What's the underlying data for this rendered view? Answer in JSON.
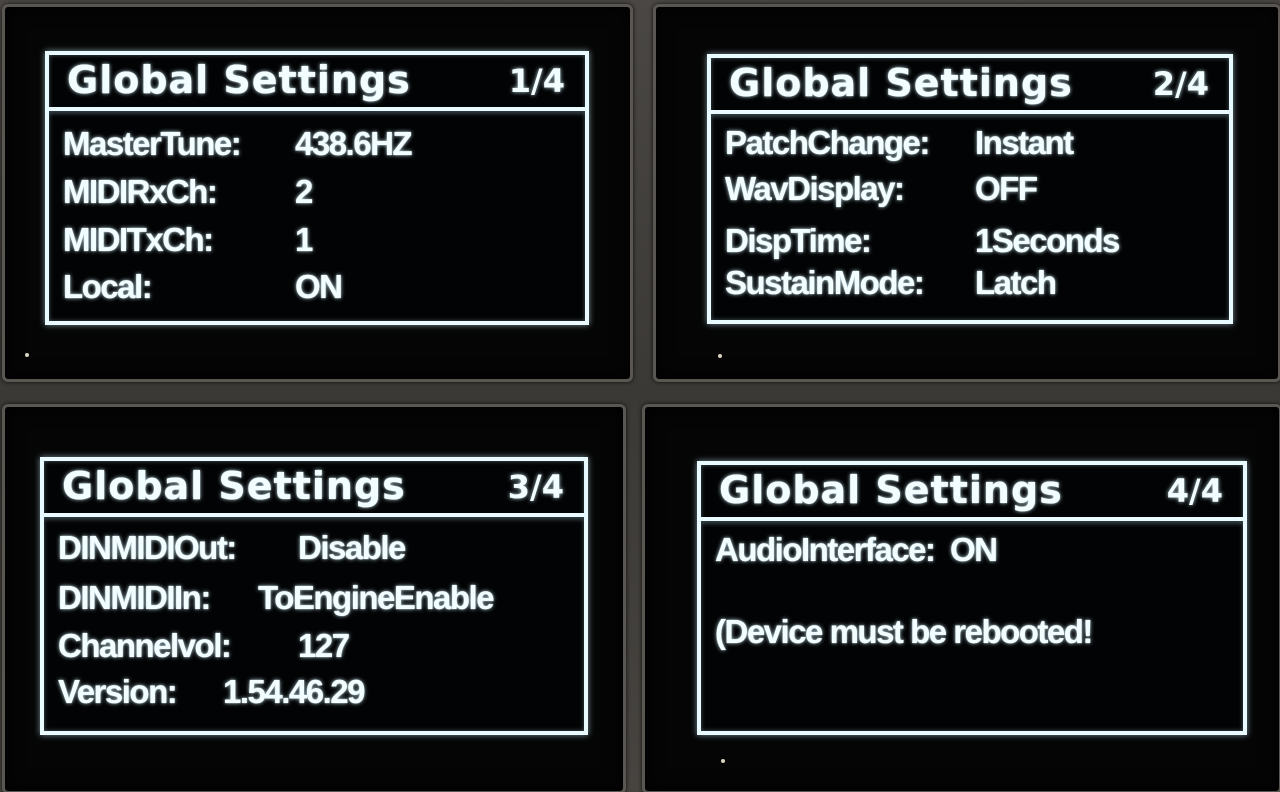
{
  "screens": [
    {
      "title": "Global Settings",
      "page": "1/4",
      "rows": [
        {
          "label": "MasterTune:",
          "value": "438.6HZ"
        },
        {
          "label": "MIDIRxCh:",
          "value": "2"
        },
        {
          "label": "MIDITxCh:",
          "value": "1"
        },
        {
          "label": "Local:",
          "value": "ON"
        }
      ]
    },
    {
      "title": "Global Settings",
      "page": "2/4",
      "rows": [
        {
          "label": "PatchChange:",
          "value": "Instant"
        },
        {
          "label": "WavDisplay:",
          "value": "OFF"
        },
        {
          "label": "DispTime:",
          "value": "1Seconds"
        },
        {
          "label": "SustainMode:",
          "value": "Latch"
        }
      ]
    },
    {
      "title": "Global Settings",
      "page": "3/4",
      "rows": [
        {
          "label": "DINMIDIOut:",
          "value": "Disable"
        },
        {
          "label": "DINMIDIIn:",
          "value": "ToEngineEnable"
        },
        {
          "label": "Channelvol:",
          "value": "127"
        },
        {
          "label": "Version:",
          "value": "1.54.46.29"
        }
      ]
    },
    {
      "title": "Global Settings",
      "page": "4/4",
      "rows": [
        {
          "label": "AudioInterface:",
          "value": "ON"
        },
        {
          "label": "",
          "value": ""
        },
        {
          "label": "(Device must be rebooted!",
          "value": ""
        }
      ]
    }
  ]
}
